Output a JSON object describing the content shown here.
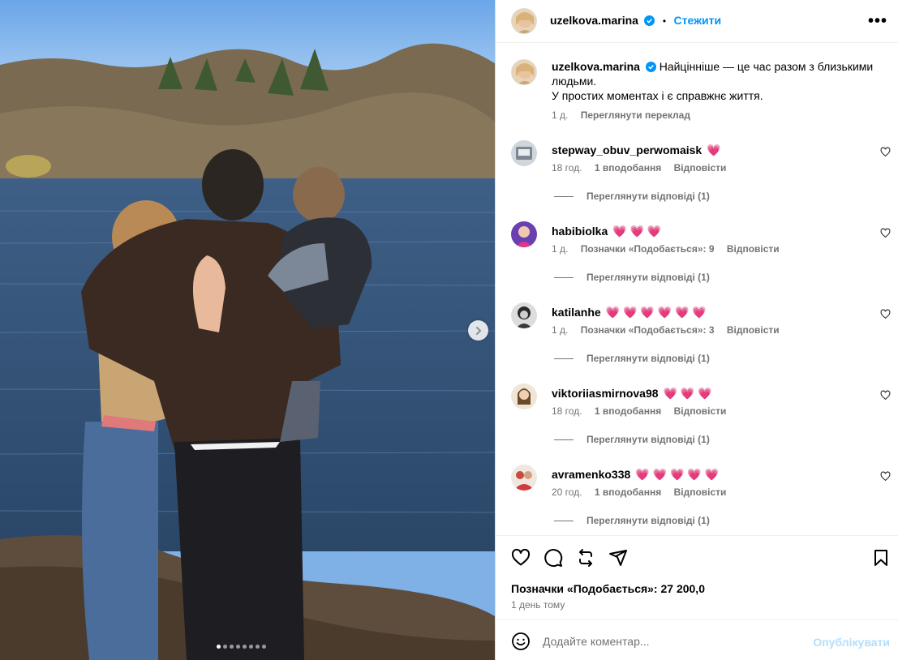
{
  "post": {
    "author": "uzelkova.marina",
    "separator": "•",
    "follow_label": "Стежити",
    "more_label": "•••",
    "caption_line1": "Найцінніше — це час разом з близькими людьми.",
    "caption_line2": "У простих моментах і є справжнє життя.",
    "caption_time": "1 д.",
    "see_translation": "Переглянути переклад",
    "carousel": {
      "slides": 8,
      "active": 1
    }
  },
  "comments": [
    {
      "user": "stepway_obuv_perwomaisk",
      "text": "💗",
      "time": "18 год.",
      "likes": "1 вподобання",
      "reply": "Відповісти",
      "view_replies": "Переглянути відповіді (1)"
    },
    {
      "user": "habibiolka",
      "text": "💗 💗 💗",
      "time": "1 д.",
      "likes": "Позначки «Подобається»: 9",
      "reply": "Відповісти",
      "view_replies": "Переглянути відповіді (1)"
    },
    {
      "user": "katilanhe",
      "text": "💗 💗 💗 💗 💗 💗",
      "time": "1 д.",
      "likes": "Позначки «Подобається»: 3",
      "reply": "Відповісти",
      "view_replies": "Переглянути відповіді (1)"
    },
    {
      "user": "viktoriiasmirnova98",
      "text": "💗 💗 💗",
      "time": "18 год.",
      "likes": "1 вподобання",
      "reply": "Відповісти",
      "view_replies": "Переглянути відповіді (1)"
    },
    {
      "user": "avramenko338",
      "text": "💗 💗 💗 💗 💗",
      "time": "20 год.",
      "likes": "1 вподобання",
      "reply": "Відповісти",
      "view_replies": "Переглянути відповіді (1)"
    }
  ],
  "footer": {
    "likes_label": "Позначки «Подобається»: 27 200,0",
    "posted_time": "1 день тому",
    "comment_placeholder": "Додайте коментар...",
    "publish_label": "Опублікувати"
  },
  "icons": {
    "like": "heart-icon",
    "comment": "comment-icon",
    "repost": "repost-icon",
    "share": "share-icon",
    "save": "bookmark-icon",
    "emoji": "emoji-icon",
    "verified": "verified-badge-icon",
    "next": "chevron-right-icon"
  },
  "colors": {
    "accent": "#0095f6",
    "muted": "#737373",
    "publish_disabled": "#b2dffc",
    "heart": "#ed4956"
  }
}
